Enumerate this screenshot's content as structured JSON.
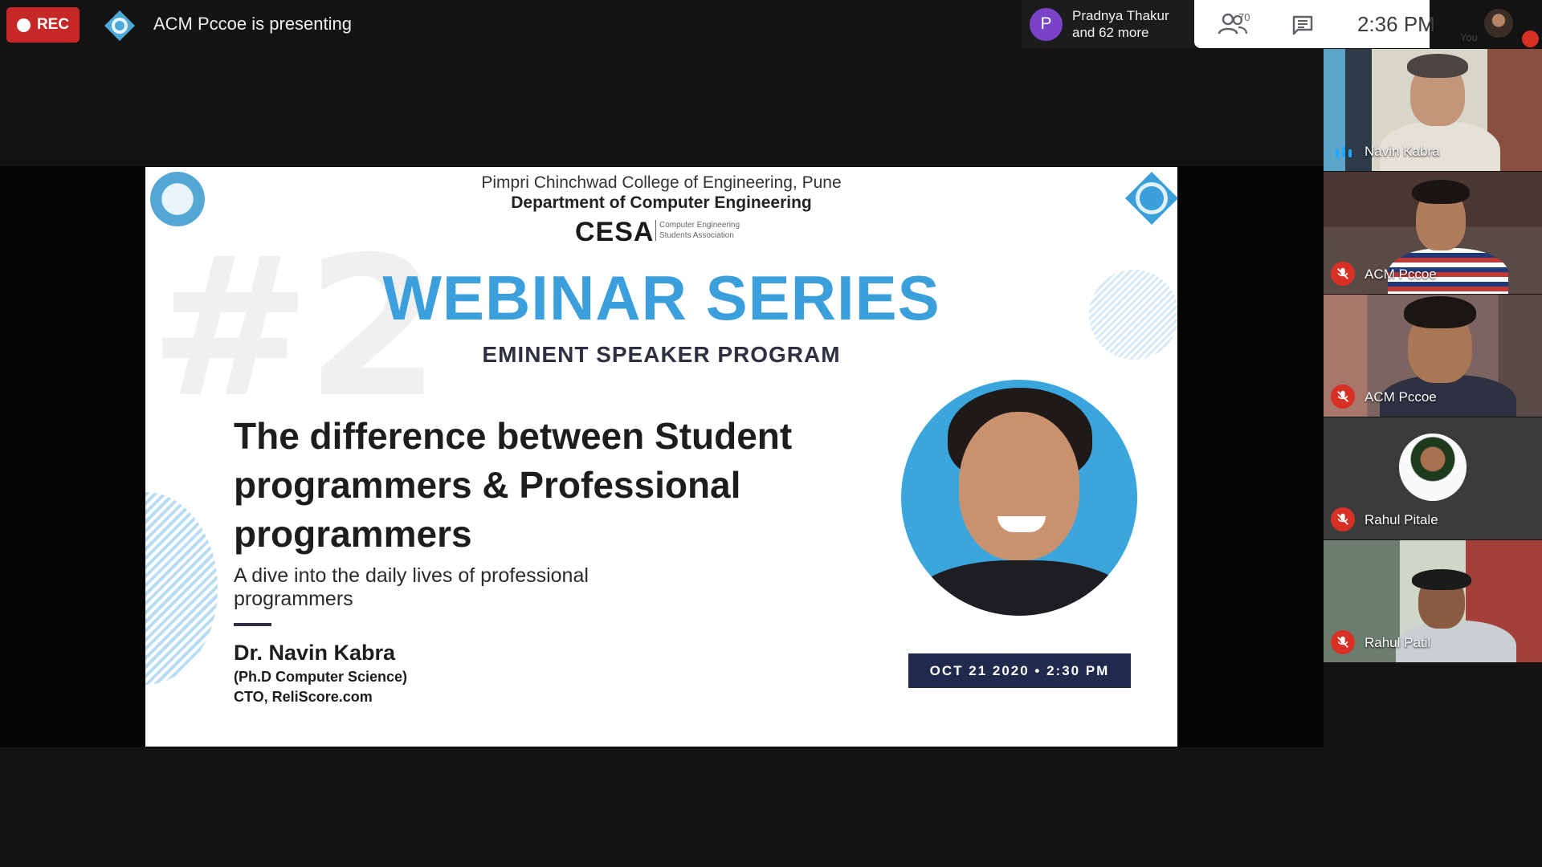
{
  "top_bar": {
    "rec_label": "REC",
    "presenting_text": "ACM Pccoe is presenting",
    "participants_chip": {
      "avatar_letter": "P",
      "line1": "Pradnya Thakur",
      "line2": "and 62 more"
    },
    "people_count": "70",
    "time": "2:36 PM",
    "you_label": "You"
  },
  "slide": {
    "big_number": "#2",
    "college": "Pimpri Chinchwad College of Engineering, Pune",
    "department": "Department of Computer Engineering",
    "cesa": "CESA",
    "cesa_sub_line1": "Computer Engineering",
    "cesa_sub_line2": "Students Association",
    "series_title": "WEBINAR SERIES",
    "program": "EMINENT SPEAKER PROGRAM",
    "talk_title": "The difference between Student programmers & Professional programmers",
    "talk_subtitle": "A dive into the daily lives of professional programmers",
    "speaker_name": "Dr. Navin Kabra",
    "speaker_degree": "(Ph.D Computer Science)",
    "speaker_role": "CTO, ReliScore.com",
    "date": "OCT 21 2020 • 2:30 PM"
  },
  "participants": [
    {
      "name": "Navin Kabra",
      "muted": false
    },
    {
      "name": "ACM Pccoe",
      "muted": true
    },
    {
      "name": "ACM Pccoe",
      "muted": true
    },
    {
      "name": "Rahul Pitale",
      "muted": true
    },
    {
      "name": "Rahul Patil",
      "muted": true
    }
  ],
  "colors": {
    "rec": "#c62828",
    "accent_blue": "#3a9fda",
    "date_box": "#1f2a4d",
    "muted_red": "#d93025",
    "avatar_purple": "#7a43c7"
  }
}
